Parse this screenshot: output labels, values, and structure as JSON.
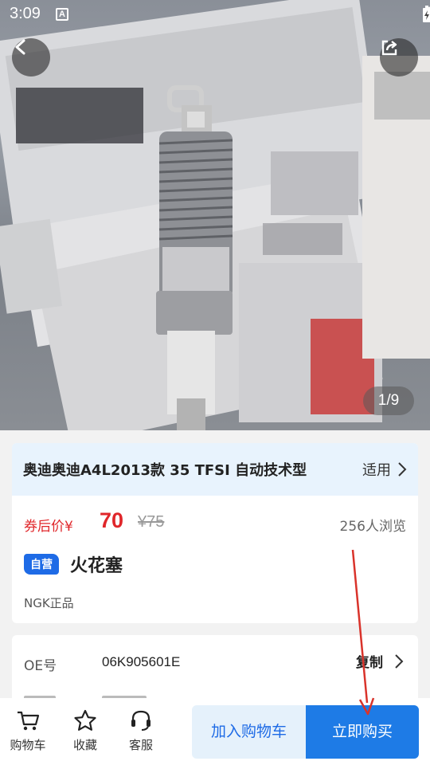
{
  "status": {
    "time": "3:09",
    "a_badge": "A"
  },
  "gallery": {
    "counter": "1/9"
  },
  "fitment": {
    "model": "奥迪奥迪A4L2013款 35 TFSI 自动技术型",
    "link_label": "适用"
  },
  "price": {
    "label": "券后价",
    "currency": "¥",
    "value": "70",
    "original": "¥75",
    "views": "256人浏览"
  },
  "product": {
    "badge": "自营",
    "name": "火花塞",
    "note": "NGK正品"
  },
  "oe": {
    "label": "OE号",
    "value": "06K905601E",
    "copy_label": "复制"
  },
  "bottom": {
    "cart_label": "购物车",
    "fav_label": "收藏",
    "service_label": "客服",
    "add_cart_label": "加入购物车",
    "buy_now_label": "立即购买"
  },
  "colors": {
    "accent_blue": "#1e6be6",
    "price_red": "#e0262a",
    "fit_bar_bg": "#e8f3fd",
    "annotation_arrow": "#d9332b"
  },
  "icons": [
    "back-icon",
    "share-icon",
    "chevron-right-icon",
    "cart-icon",
    "star-icon",
    "headset-icon",
    "wifi-icon",
    "signal-icon",
    "battery-icon"
  ]
}
